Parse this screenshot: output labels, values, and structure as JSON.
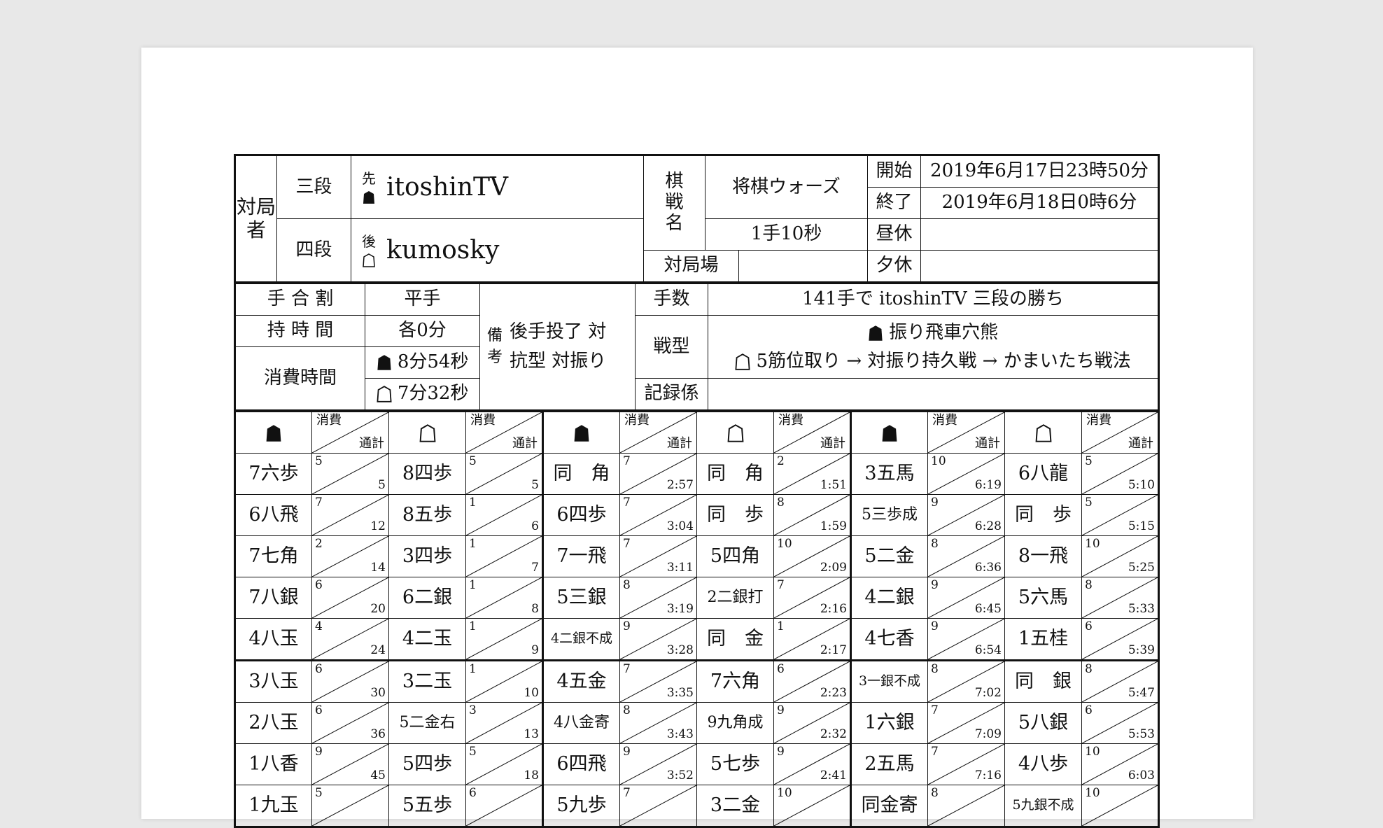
{
  "header": {
    "taikyokusha_label": "対局者",
    "sente_rank": "三段",
    "sente_side_label": "先",
    "sente_name": "itoshinTV",
    "gote_rank": "四段",
    "gote_side_label": "後",
    "gote_name": "kumosky",
    "kisen_label": "棋戦名",
    "kisen_value": "将棋ウォーズ",
    "time_control": "1手10秒",
    "venue_label": "対局場",
    "venue_value": "",
    "start_label": "開始",
    "start_value": "2019年6月17日23時50分",
    "end_label": "終了",
    "end_value": "2019年6月18日0時6分",
    "lunch_label": "昼休",
    "lunch_value": "",
    "dinner_label": "夕休",
    "dinner_value": ""
  },
  "info": {
    "handicap_label": "手 合 割",
    "handicap_value": "平手",
    "mochi_label": "持 時 間",
    "mochi_value": "各0分",
    "shohi_label": "消費時間",
    "sente_used": "8分54秒",
    "gote_used": "7分32秒",
    "biko_label": "備考",
    "biko_value_1": "後手投了 対",
    "biko_value_2": "抗型 対振り",
    "tesu_label": "手数",
    "tesu_value": "141手で itoshinTV 三段の勝ち",
    "senkei_label": "戦型",
    "senkei_sente": "振り飛車穴熊",
    "senkei_gote": "5筋位取り → 対振り持久戦 → かまいたち戦法",
    "kiroku_label": "記録係",
    "kiroku_value": ""
  },
  "moves_header": {
    "l1": "消費",
    "l2": "通計"
  },
  "moves": [
    [
      [
        "7六歩",
        "5",
        "5"
      ],
      [
        "8四歩",
        "5",
        "5"
      ],
      [
        "同　角",
        "7",
        "2:57"
      ],
      [
        "同　角",
        "2",
        "1:51"
      ],
      [
        "3五馬",
        "10",
        "6:19"
      ],
      [
        "6八龍",
        "5",
        "5:10"
      ]
    ],
    [
      [
        "6八飛",
        "7",
        "12"
      ],
      [
        "8五歩",
        "1",
        "6"
      ],
      [
        "6四歩",
        "7",
        "3:04"
      ],
      [
        "同　歩",
        "8",
        "1:59"
      ],
      [
        "5三歩成",
        "9",
        "6:28"
      ],
      [
        "同　歩",
        "5",
        "5:15"
      ]
    ],
    [
      [
        "7七角",
        "2",
        "14"
      ],
      [
        "3四歩",
        "1",
        "7"
      ],
      [
        "7一飛",
        "7",
        "3:11"
      ],
      [
        "5四角",
        "10",
        "2:09"
      ],
      [
        "5二金",
        "8",
        "6:36"
      ],
      [
        "8一飛",
        "10",
        "5:25"
      ]
    ],
    [
      [
        "7八銀",
        "6",
        "20"
      ],
      [
        "6二銀",
        "1",
        "8"
      ],
      [
        "5三銀",
        "8",
        "3:19"
      ],
      [
        "2二銀打",
        "7",
        "2:16"
      ],
      [
        "4二銀",
        "9",
        "6:45"
      ],
      [
        "5六馬",
        "8",
        "5:33"
      ]
    ],
    [
      [
        "4八玉",
        "4",
        "24"
      ],
      [
        "4二玉",
        "1",
        "9"
      ],
      [
        "4二銀不成",
        "9",
        "3:28"
      ],
      [
        "同　金",
        "1",
        "2:17"
      ],
      [
        "4七香",
        "9",
        "6:54"
      ],
      [
        "1五桂",
        "6",
        "5:39"
      ]
    ],
    [
      [
        "3八玉",
        "6",
        "30"
      ],
      [
        "3二玉",
        "1",
        "10"
      ],
      [
        "4五金",
        "7",
        "3:35"
      ],
      [
        "7六角",
        "6",
        "2:23"
      ],
      [
        "3一銀不成",
        "8",
        "7:02"
      ],
      [
        "同　銀",
        "8",
        "5:47"
      ]
    ],
    [
      [
        "2八玉",
        "6",
        "36"
      ],
      [
        "5二金右",
        "3",
        "13"
      ],
      [
        "4八金寄",
        "8",
        "3:43"
      ],
      [
        "9九角成",
        "9",
        "2:32"
      ],
      [
        "1六銀",
        "7",
        "7:09"
      ],
      [
        "5八銀",
        "6",
        "5:53"
      ]
    ],
    [
      [
        "1八香",
        "9",
        "45"
      ],
      [
        "5四歩",
        "5",
        "18"
      ],
      [
        "6四飛",
        "9",
        "3:52"
      ],
      [
        "5七歩",
        "9",
        "2:41"
      ],
      [
        "2五馬",
        "7",
        "7:16"
      ],
      [
        "4八歩",
        "10",
        "6:03"
      ]
    ],
    [
      [
        "1九玉",
        "5",
        "",
        ""
      ],
      [
        "5五歩",
        "6",
        "",
        ""
      ],
      [
        "5九歩",
        "7",
        "",
        ""
      ],
      [
        "3二金",
        "10",
        "",
        ""
      ],
      [
        "同金寄",
        "8",
        "",
        ""
      ],
      [
        "5九銀不成",
        "10",
        "",
        ""
      ]
    ]
  ]
}
